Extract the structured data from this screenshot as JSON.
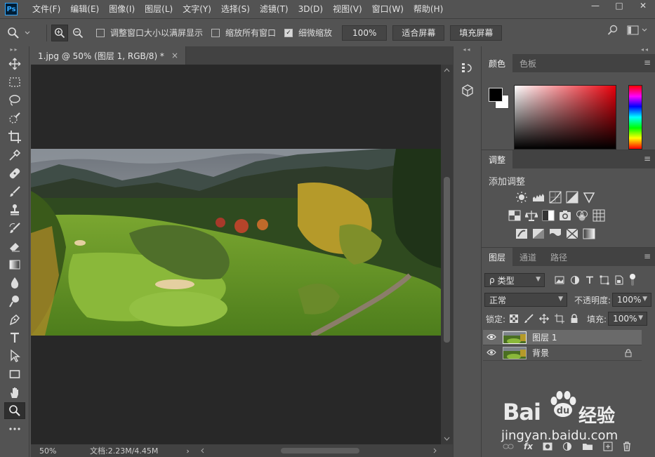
{
  "app": {
    "logo": "Ps"
  },
  "menu": [
    "文件(F)",
    "编辑(E)",
    "图像(I)",
    "图层(L)",
    "文字(Y)",
    "选择(S)",
    "滤镜(T)",
    "3D(D)",
    "视图(V)",
    "窗口(W)",
    "帮助(H)"
  ],
  "window_controls": {
    "minimize": "—",
    "maximize": "□",
    "close": "✕"
  },
  "options": {
    "resize_windows": "调整窗口大小以满屏显示",
    "zoom_all_windows": "缩放所有窗口",
    "scrubby_zoom": "细微缩放",
    "resize_windows_checked": false,
    "zoom_all_checked": false,
    "scrubby_zoom_checked": true,
    "zoom_value": "100%",
    "fit_screen": "适合屏幕",
    "fill_screen": "填充屏幕"
  },
  "document": {
    "tab_title": "1.jpg @ 50% (图层 1, RGB/8) *",
    "tab_close": "×",
    "zoom": "50%",
    "doc_size": "文档:2.23M/4.45M",
    "status_arrow": "›"
  },
  "color_panel": {
    "tabs": [
      "颜色",
      "色板"
    ],
    "foreground": "#000000",
    "background": "#ffffff",
    "hue_color": "#e8000b"
  },
  "adjust_panel": {
    "tab": "调整",
    "title": "添加调整"
  },
  "layers_panel": {
    "tabs": [
      "图层",
      "通道",
      "路径"
    ],
    "filter_kind": "类型",
    "filter_prefix": "ρ",
    "blend_mode": "正常",
    "opacity_label": "不透明度:",
    "opacity_value": "100%",
    "lock_label": "锁定:",
    "fill_label": "填充:",
    "fill_value": "100%",
    "layers": [
      {
        "name": "图层 1",
        "selected": true,
        "locked": false
      },
      {
        "name": "背景",
        "selected": false,
        "locked": true
      }
    ],
    "footer_fx": "fx"
  },
  "watermark": {
    "brand_text": "Bai",
    "brand_text_2": "经验",
    "url": "jingyan.baidu.com"
  },
  "colors": {
    "accent": "#31a8ff",
    "panel_bg": "#535353",
    "canvas_bg": "#282828"
  }
}
